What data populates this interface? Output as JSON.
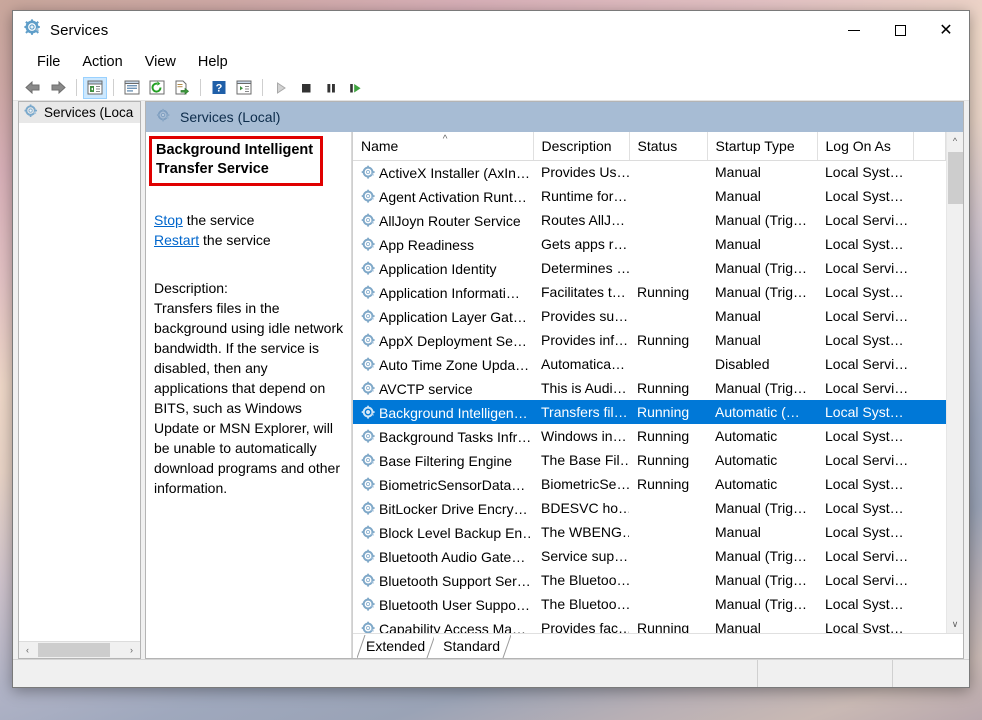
{
  "window": {
    "title": "Services",
    "icon": "services-gear-icon",
    "controls": {
      "minimize": "—",
      "maximize": "□",
      "close": "✕"
    }
  },
  "menubar": {
    "items": [
      "File",
      "Action",
      "View",
      "Help"
    ]
  },
  "toolbar": {
    "buttons": [
      {
        "name": "back-icon",
        "glyph": "back-arrow"
      },
      {
        "name": "forward-icon",
        "glyph": "forward-arrow"
      },
      {
        "name": "show-hide-console-tree-icon",
        "glyph": "tree-pane",
        "selected": true
      },
      {
        "name": "properties-icon",
        "glyph": "properties"
      },
      {
        "name": "refresh-icon",
        "glyph": "refresh"
      },
      {
        "name": "export-list-icon",
        "glyph": "export"
      },
      {
        "name": "help-icon",
        "glyph": "question"
      },
      {
        "name": "show-action-pane-icon",
        "glyph": "action-pane"
      },
      {
        "name": "start-service-icon",
        "glyph": "play"
      },
      {
        "name": "stop-service-icon",
        "glyph": "stop"
      },
      {
        "name": "pause-service-icon",
        "glyph": "pause"
      },
      {
        "name": "restart-service-icon",
        "glyph": "restart"
      }
    ]
  },
  "tree": {
    "root_label": "Services (Loca",
    "root_icon": "services-gear-icon",
    "hscroll": {
      "left": "‹",
      "right": "›"
    }
  },
  "pane": {
    "header_label": "Services (Local)",
    "header_icon": "services-gear-icon",
    "header_color": "#a7bcd4"
  },
  "detail": {
    "service_name": "Background Intelligent Transfer Service",
    "annotation_color": "#e00000",
    "actions": [
      {
        "link": "Stop",
        "suffix": " the service"
      },
      {
        "link": "Restart",
        "suffix": " the service"
      }
    ],
    "description_label": "Description:",
    "description": "Transfers files in the background using idle network bandwidth. If the service is disabled, then any applications that depend on BITS, such as Windows Update or MSN Explorer, will be unable to automatically download programs and other information."
  },
  "list": {
    "sort_column": "Name",
    "sort_direction": "ascending",
    "sort_glyph": "^",
    "columns": [
      "Name",
      "Description",
      "Status",
      "Startup Type",
      "Log On As"
    ],
    "selection_color": "#0078d7",
    "rows": [
      {
        "name": "ActiveX Installer (AxIn…",
        "description": "Provides Us…",
        "status": "",
        "startup": "Manual",
        "logon": "Local Syst…",
        "selected": false
      },
      {
        "name": "Agent Activation Runt…",
        "description": "Runtime for…",
        "status": "",
        "startup": "Manual",
        "logon": "Local Syst…",
        "selected": false
      },
      {
        "name": "AllJoyn Router Service",
        "description": "Routes AllJ…",
        "status": "",
        "startup": "Manual (Trig…",
        "logon": "Local Servi…",
        "selected": false
      },
      {
        "name": "App Readiness",
        "description": "Gets apps r…",
        "status": "",
        "startup": "Manual",
        "logon": "Local Syst…",
        "selected": false
      },
      {
        "name": "Application Identity",
        "description": "Determines …",
        "status": "",
        "startup": "Manual (Trig…",
        "logon": "Local Servi…",
        "selected": false
      },
      {
        "name": "Application Informati…",
        "description": "Facilitates t…",
        "status": "Running",
        "startup": "Manual (Trig…",
        "logon": "Local Syst…",
        "selected": false
      },
      {
        "name": "Application Layer Gat…",
        "description": "Provides su…",
        "status": "",
        "startup": "Manual",
        "logon": "Local Servi…",
        "selected": false
      },
      {
        "name": "AppX Deployment Se…",
        "description": "Provides inf…",
        "status": "Running",
        "startup": "Manual",
        "logon": "Local Syst…",
        "selected": false
      },
      {
        "name": "Auto Time Zone Upda…",
        "description": "Automatica…",
        "status": "",
        "startup": "Disabled",
        "logon": "Local Servi…",
        "selected": false
      },
      {
        "name": "AVCTP service",
        "description": "This is Audi…",
        "status": "Running",
        "startup": "Manual (Trig…",
        "logon": "Local Servi…",
        "selected": false
      },
      {
        "name": "Background Intelligen…",
        "description": "Transfers fil…",
        "status": "Running",
        "startup": "Automatic (…",
        "logon": "Local Syst…",
        "selected": true
      },
      {
        "name": "Background Tasks Infr…",
        "description": "Windows in…",
        "status": "Running",
        "startup": "Automatic",
        "logon": "Local Syst…",
        "selected": false
      },
      {
        "name": "Base Filtering Engine",
        "description": "The Base Fil…",
        "status": "Running",
        "startup": "Automatic",
        "logon": "Local Servi…",
        "selected": false
      },
      {
        "name": "BiometricSensorData…",
        "description": "BiometricSe…",
        "status": "Running",
        "startup": "Automatic",
        "logon": "Local Syst…",
        "selected": false
      },
      {
        "name": "BitLocker Drive Encry…",
        "description": "BDESVC ho…",
        "status": "",
        "startup": "Manual (Trig…",
        "logon": "Local Syst…",
        "selected": false
      },
      {
        "name": "Block Level Backup En…",
        "description": "The WBENG…",
        "status": "",
        "startup": "Manual",
        "logon": "Local Syst…",
        "selected": false
      },
      {
        "name": "Bluetooth Audio Gate…",
        "description": "Service sup…",
        "status": "",
        "startup": "Manual (Trig…",
        "logon": "Local Servi…",
        "selected": false
      },
      {
        "name": "Bluetooth Support Ser…",
        "description": "The Bluetoo…",
        "status": "",
        "startup": "Manual (Trig…",
        "logon": "Local Servi…",
        "selected": false
      },
      {
        "name": "Bluetooth User Suppo…",
        "description": "The Bluetoo…",
        "status": "",
        "startup": "Manual (Trig…",
        "logon": "Local Syst…",
        "selected": false
      },
      {
        "name": "Capability Access Ma…",
        "description": "Provides fac…",
        "status": "Running",
        "startup": "Manual",
        "logon": "Local Syst…",
        "selected": false
      }
    ],
    "vscroll": {
      "up": "^",
      "down": "∨"
    }
  },
  "tabs": [
    {
      "label": "Extended",
      "active": true
    },
    {
      "label": "Standard",
      "active": false
    }
  ],
  "statusbar": {
    "cells": [
      "",
      "",
      ""
    ]
  }
}
